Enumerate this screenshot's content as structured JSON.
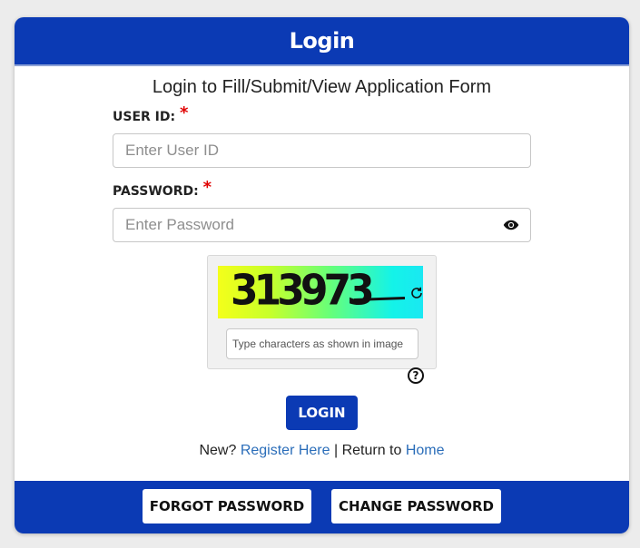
{
  "header": {
    "title": "Login"
  },
  "subtitle": "Login to Fill/Submit/View Application Form",
  "user_id": {
    "label": "USER ID:",
    "required_mark": "*",
    "placeholder": "Enter User ID"
  },
  "password": {
    "label": "PASSWORD:",
    "required_mark": "*",
    "placeholder": "Enter Password",
    "toggle_icon": "eye-icon"
  },
  "captcha": {
    "image_text": "313973",
    "input_placeholder": "Type characters as shown in image",
    "refresh_icon": "refresh-icon",
    "help_icon": "help-icon",
    "help_glyph": "?"
  },
  "login_button": "LOGIN",
  "links": {
    "new_prefix": "New?",
    "register": "Register Here",
    "separator": "|",
    "return_prefix": "Return to",
    "home": "Home"
  },
  "footer": {
    "forgot_password": "FORGOT PASSWORD",
    "change_password": "CHANGE PASSWORD"
  },
  "colors": {
    "primary": "#0b3ab4",
    "required": "#e00000",
    "link": "#2a6db9",
    "background": "#ececec"
  }
}
